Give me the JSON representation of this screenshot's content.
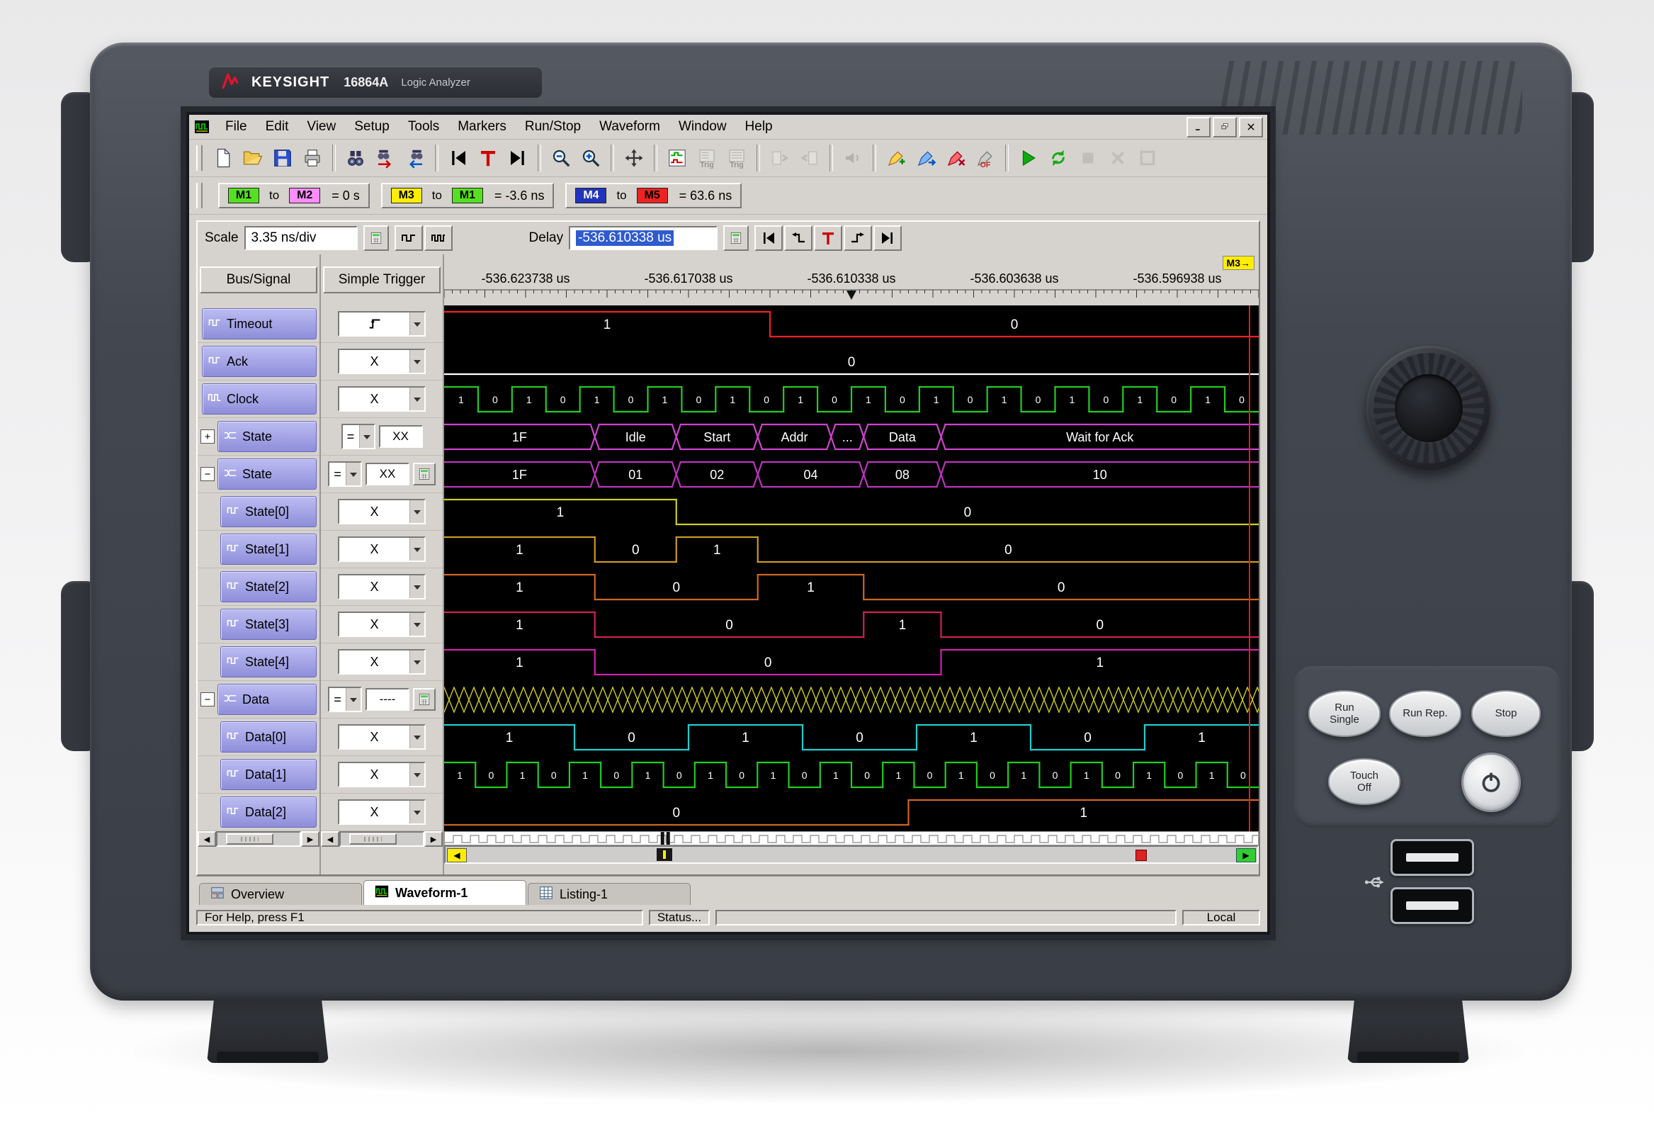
{
  "device": {
    "brand": "KEYSIGHT",
    "model": "16864A",
    "product": "Logic Analyzer",
    "hard_buttons": [
      {
        "id": "run-single",
        "lines": [
          "Run",
          "Single"
        ]
      },
      {
        "id": "run-rep",
        "lines": [
          "Run Rep."
        ]
      },
      {
        "id": "stop",
        "lines": [
          "Stop"
        ]
      },
      {
        "id": "touch-off",
        "lines": [
          "Touch",
          "Off"
        ]
      }
    ]
  },
  "app": {
    "menus": [
      "File",
      "Edit",
      "View",
      "Setup",
      "Tools",
      "Markers",
      "Run/Stop",
      "Waveform",
      "Window",
      "Help"
    ],
    "toolbar": [
      {
        "name": "new-file-icon",
        "group": 0
      },
      {
        "name": "open-folder-icon",
        "group": 0
      },
      {
        "name": "save-icon",
        "group": 0
      },
      {
        "name": "print-icon",
        "group": 0
      },
      {
        "name": "find-icon",
        "group": 1
      },
      {
        "name": "find-next-icon",
        "group": 1
      },
      {
        "name": "find-prev-icon",
        "group": 1
      },
      {
        "name": "goto-begin-icon",
        "group": 2
      },
      {
        "name": "goto-trigger-icon",
        "group": 2
      },
      {
        "name": "goto-end-icon",
        "group": 2
      },
      {
        "name": "zoom-out-icon",
        "group": 3
      },
      {
        "name": "zoom-in-icon",
        "group": 3
      },
      {
        "name": "pan-tool-icon",
        "group": 4
      },
      {
        "name": "bus-signal-setup-icon",
        "group": 5
      },
      {
        "name": "trigger-list-icon",
        "group": 5,
        "disabled": true,
        "text": "Trig"
      },
      {
        "name": "trigger-settings-icon",
        "group": 5,
        "disabled": true,
        "text": "Trig"
      },
      {
        "name": "compare-1-icon",
        "group": 6,
        "disabled": true
      },
      {
        "name": "compare-2-icon",
        "group": 6,
        "disabled": true
      },
      {
        "name": "sound-icon",
        "group": 7,
        "disabled": true
      },
      {
        "name": "marker-add-icon",
        "group": 8
      },
      {
        "name": "marker-next-icon",
        "group": 8
      },
      {
        "name": "marker-delete-icon",
        "group": 8
      },
      {
        "name": "marker-overflow-icon",
        "group": 8,
        "text": "OF"
      },
      {
        "name": "run-icon",
        "group": 9
      },
      {
        "name": "run-repetitive-icon",
        "group": 9
      },
      {
        "name": "stop-icon",
        "group": 9,
        "disabled": true
      },
      {
        "name": "cancel-icon",
        "group": 9,
        "disabled": true
      },
      {
        "name": "stop-all-icon",
        "group": 9,
        "disabled": true
      }
    ],
    "marker_bar": [
      {
        "a": "M1",
        "a_bg": "#55e022",
        "a_fg": "#000000",
        "join": "to",
        "b": "M2",
        "b_bg": "#ff8cff",
        "b_fg": "#000000",
        "value": "= 0 s"
      },
      {
        "a": "M3",
        "a_bg": "#ffee00",
        "a_fg": "#000000",
        "join": "to",
        "b": "M1",
        "b_bg": "#55e022",
        "b_fg": "#000000",
        "value": "= -3.6 ns"
      },
      {
        "a": "M4",
        "a_bg": "#2233bb",
        "a_fg": "#ffffff",
        "join": "to",
        "b": "M5",
        "b_bg": "#ee2222",
        "b_fg": "#000000",
        "value": "= 63.6 ns"
      }
    ],
    "controls": {
      "scale_label": "Scale",
      "scale_value": "3.35 ns/div",
      "delay_label": "Delay",
      "delay_value": "-536.610338 us"
    },
    "timeline": {
      "labels": [
        "-536.623738 us",
        "-536.617038 us",
        "-536.610338 us",
        "-536.603638 us",
        "-536.596938 us"
      ],
      "marker_chip": "M3→",
      "marker_chip_bg": "#ffee00"
    },
    "signals": {
      "bus_header": "Bus/Signal",
      "trigger_header": "Simple Trigger",
      "rows": [
        {
          "name": "Timeout",
          "icon": "sig-icon",
          "indent": 0,
          "trigger": {
            "kind": "edge"
          },
          "wave": {
            "type": "digital",
            "color": "#ee2222",
            "segments": [
              {
                "v": 1,
                "w": 0.4,
                "label": "1"
              },
              {
                "v": 0,
                "w": 0.6,
                "label": "0"
              }
            ]
          }
        },
        {
          "name": "Ack",
          "icon": "sig-icon",
          "indent": 0,
          "trigger": {
            "kind": "dontcare",
            "value": "X"
          },
          "wave": {
            "type": "digital",
            "color": "#ffffff",
            "segments": [
              {
                "v": 0,
                "w": 1.0,
                "label": "0"
              }
            ]
          }
        },
        {
          "name": "Clock",
          "icon": "clk-icon",
          "indent": 0,
          "trigger": {
            "kind": "dontcare",
            "value": "X"
          },
          "wave": {
            "type": "clock",
            "color": "#22cc22",
            "halfcycles": 24,
            "start": 1,
            "labels_repeat": [
              "1",
              "0"
            ]
          }
        },
        {
          "name": "State",
          "icon": "bus2-icon",
          "indent": 0,
          "expander": "plus",
          "trigger": {
            "kind": "compare",
            "op": "=",
            "value": "XX",
            "calc": false
          },
          "wave": {
            "type": "bus",
            "color": "#cc44cc",
            "cells": [
              {
                "label": "1F",
                "w": 0.185
              },
              {
                "label": "Idle",
                "w": 0.1
              },
              {
                "label": "Start",
                "w": 0.1
              },
              {
                "label": "Addr",
                "w": 0.09
              },
              {
                "label": "...",
                "w": 0.04
              },
              {
                "label": "Data",
                "w": 0.095
              },
              {
                "label": "Wait for Ack",
                "w": 0.39
              }
            ]
          }
        },
        {
          "name": "State",
          "icon": "bus2-icon",
          "indent": 0,
          "expander": "minus",
          "trigger": {
            "kind": "compare",
            "op": "=",
            "value": "XX",
            "calc": true
          },
          "wave": {
            "type": "bus",
            "color": "#bb33bb",
            "cells": [
              {
                "label": "1F",
                "w": 0.185
              },
              {
                "label": "01",
                "w": 0.1
              },
              {
                "label": "02",
                "w": 0.1
              },
              {
                "label": "04",
                "w": 0.13
              },
              {
                "label": "08",
                "w": 0.095
              },
              {
                "label": "10",
                "w": 0.39
              }
            ]
          }
        },
        {
          "name": "State[0]",
          "icon": "sig-icon",
          "indent": 1,
          "trigger": {
            "kind": "dontcare",
            "value": "X"
          },
          "wave": {
            "type": "digital",
            "color": "#cccc22",
            "segments": [
              {
                "v": 1,
                "w": 0.285,
                "label": "1"
              },
              {
                "v": 0,
                "w": 0.715,
                "label": "0"
              }
            ]
          }
        },
        {
          "name": "State[1]",
          "icon": "sig-icon",
          "indent": 1,
          "trigger": {
            "kind": "dontcare",
            "value": "X"
          },
          "wave": {
            "type": "digital",
            "color": "#cc9922",
            "segments": [
              {
                "v": 1,
                "w": 0.185,
                "label": "1"
              },
              {
                "v": 0,
                "w": 0.1,
                "label": "0"
              },
              {
                "v": 1,
                "w": 0.1,
                "label": "1"
              },
              {
                "v": 0,
                "w": 0.615,
                "label": "0"
              }
            ]
          }
        },
        {
          "name": "State[2]",
          "icon": "sig-icon",
          "indent": 1,
          "trigger": {
            "kind": "dontcare",
            "value": "X"
          },
          "wave": {
            "type": "digital",
            "color": "#cc6622",
            "segments": [
              {
                "v": 1,
                "w": 0.185,
                "label": "1"
              },
              {
                "v": 0,
                "w": 0.2,
                "label": "0"
              },
              {
                "v": 1,
                "w": 0.13,
                "label": "1"
              },
              {
                "v": 0,
                "w": 0.485,
                "label": "0"
              }
            ]
          }
        },
        {
          "name": "State[3]",
          "icon": "sig-icon",
          "indent": 1,
          "trigger": {
            "kind": "dontcare",
            "value": "X"
          },
          "wave": {
            "type": "digital",
            "color": "#cc2255",
            "segments": [
              {
                "v": 1,
                "w": 0.185,
                "label": "1"
              },
              {
                "v": 0,
                "w": 0.33,
                "label": "0"
              },
              {
                "v": 1,
                "w": 0.095,
                "label": "1"
              },
              {
                "v": 0,
                "w": 0.39,
                "label": "0"
              }
            ]
          }
        },
        {
          "name": "State[4]",
          "icon": "sig-icon",
          "indent": 1,
          "trigger": {
            "kind": "dontcare",
            "value": "X"
          },
          "wave": {
            "type": "digital",
            "color": "#cc22aa",
            "segments": [
              {
                "v": 1,
                "w": 0.185,
                "label": "1"
              },
              {
                "v": 0,
                "w": 0.425,
                "label": "0"
              },
              {
                "v": 1,
                "w": 0.39,
                "label": "1"
              }
            ]
          }
        },
        {
          "name": "Data",
          "icon": "bus2-icon",
          "indent": 0,
          "expander": "minus",
          "trigger": {
            "kind": "compare",
            "op": "=",
            "value": "----",
            "calc": true
          },
          "wave": {
            "type": "busy",
            "color": "#cccc22"
          }
        },
        {
          "name": "Data[0]",
          "icon": "sig-icon",
          "indent": 1,
          "trigger": {
            "kind": "dontcare",
            "value": "X"
          },
          "wave": {
            "type": "digital",
            "color": "#22cccc",
            "segments": [
              {
                "v": 1,
                "w": 0.16,
                "label": "1"
              },
              {
                "v": 0,
                "w": 0.14,
                "label": "0"
              },
              {
                "v": 1,
                "w": 0.14,
                "label": "1"
              },
              {
                "v": 0,
                "w": 0.14,
                "label": "0"
              },
              {
                "v": 1,
                "w": 0.14,
                "label": "1"
              },
              {
                "v": 0,
                "w": 0.14,
                "label": "0"
              },
              {
                "v": 1,
                "w": 0.14,
                "label": "1"
              }
            ]
          }
        },
        {
          "name": "Data[1]",
          "icon": "sig-icon",
          "indent": 1,
          "trigger": {
            "kind": "dontcare",
            "value": "X"
          },
          "wave": {
            "type": "clock",
            "color": "#22cc22",
            "halfcycles": 26,
            "start": 1,
            "labels_repeat": [
              "1",
              "0"
            ]
          }
        },
        {
          "name": "Data[2]",
          "icon": "sig-icon",
          "indent": 1,
          "trigger": {
            "kind": "dontcare",
            "value": "X"
          },
          "wave": {
            "type": "digital",
            "color": "#cc6622",
            "segments": [
              {
                "v": 0,
                "w": 0.57,
                "label": "0"
              },
              {
                "v": 1,
                "w": 0.43,
                "label": "1"
              }
            ]
          }
        }
      ]
    },
    "tabs": [
      {
        "label": "Overview",
        "icon": "tab-overview-icon",
        "active": false
      },
      {
        "label": "Waveform-1",
        "icon": "tab-waveform-icon",
        "active": true
      },
      {
        "label": "Listing-1",
        "icon": "tab-listing-icon",
        "active": false
      }
    ],
    "statusbar": {
      "help": "For Help, press F1",
      "status": "Status...",
      "mode": "Local"
    }
  }
}
